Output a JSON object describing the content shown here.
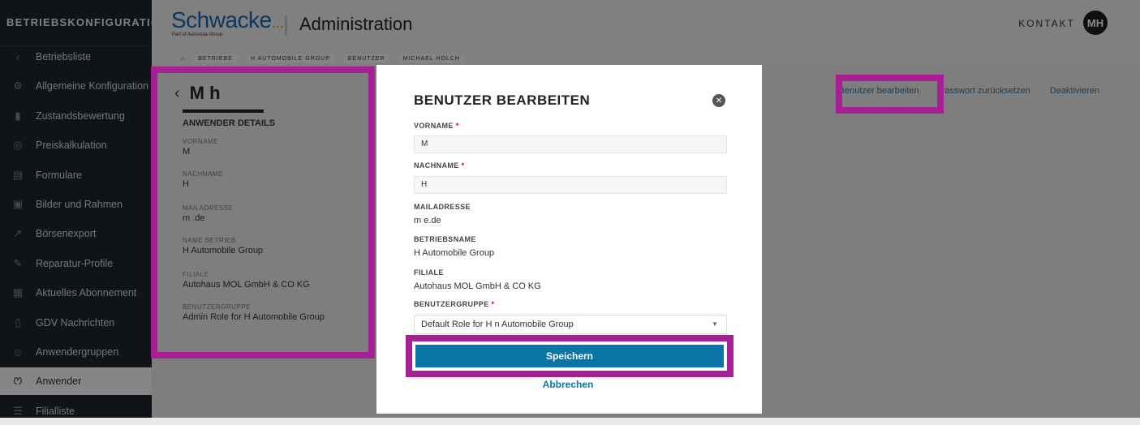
{
  "sidebar": {
    "title": "BETRIEBSKONFIGURATION",
    "items": [
      {
        "label": "Betriebsliste",
        "icon": "chevron-left-icon",
        "glyph": "‹"
      },
      {
        "label": "Allgemeine Konfiguration",
        "icon": "settings-icon",
        "glyph": "⚙"
      },
      {
        "label": "Zustandsbewertung",
        "icon": "rating-icon",
        "glyph": "▮"
      },
      {
        "label": "Preiskalkulation",
        "icon": "price-icon",
        "glyph": "◎"
      },
      {
        "label": "Formulare",
        "icon": "form-icon",
        "glyph": "▤"
      },
      {
        "label": "Bilder und Rahmen",
        "icon": "image-icon",
        "glyph": "▣"
      },
      {
        "label": "Börsenexport",
        "icon": "export-icon",
        "glyph": "↗"
      },
      {
        "label": "Reparatur-Profile",
        "icon": "wrench-icon",
        "glyph": "✎"
      },
      {
        "label": "Aktuelles Abonnement",
        "icon": "subscription-icon",
        "glyph": "▦"
      },
      {
        "label": "GDV Nachrichten",
        "icon": "message-icon",
        "glyph": "▯"
      },
      {
        "label": "Anwendergruppen",
        "icon": "group-icon",
        "glyph": "☺"
      },
      {
        "label": "Anwender",
        "icon": "users-icon",
        "glyph": "ꯁ"
      },
      {
        "label": "Filialliste",
        "icon": "list-icon",
        "glyph": "☰"
      }
    ],
    "active_index": 11
  },
  "header": {
    "logo": "Schwacke",
    "logo_dots": "....",
    "logo_sub": "Part of Autovista Group",
    "separator": "|",
    "title": "Administration",
    "kontakt": "KONTAKT",
    "avatar": "MH"
  },
  "breadcrumb": [
    "BETRIEBE",
    "H AUTOMOBILE GROUP",
    "BENUTZER",
    "MICHAEL HOLCH"
  ],
  "actions": {
    "edit": "Benutzer bearbeiten",
    "reset": "Passwort zurücksetzen",
    "deactivate": "Deaktivieren"
  },
  "user_panel": {
    "name": "M h",
    "heading": "ANWENDER DETAILS",
    "fields": [
      {
        "label": "VORNAME",
        "value": "M"
      },
      {
        "label": "NACHNAME",
        "value": "H"
      },
      {
        "label": "MAILADRESSE",
        "value": "m .de"
      },
      {
        "label": "NAME BETRIEB",
        "value": "H Automobile Group"
      },
      {
        "label": "FILIALE",
        "value": "Autohaus MOL GmbH & CO KG"
      },
      {
        "label": "BENUTZERGRUPPE",
        "value": "Admin Role for H Automobile Group"
      }
    ]
  },
  "modal": {
    "title": "BENUTZER BEARBEITEN",
    "vorname_label": "VORNAME",
    "vorname_value": "M",
    "nachname_label": "NACHNAME",
    "nachname_value": "H",
    "mail_label": "MAILADRESSE",
    "mail_value": "m e.de",
    "betrieb_label": "BETRIEBSNAME",
    "betrieb_value": "H Automobile Group",
    "filiale_label": "FILIALE",
    "filiale_value": "Autohaus MOL GmbH & CO KG",
    "gruppe_label": "BENUTZERGRUPPE",
    "gruppe_value": "Default Role for H n Automobile Group",
    "required_mark": "*",
    "save": "Speichern",
    "cancel": "Abbrechen"
  },
  "colors": {
    "highlight": "#a81f93",
    "primary": "#0c75a8",
    "sidebar_bg": "#1e262c"
  }
}
